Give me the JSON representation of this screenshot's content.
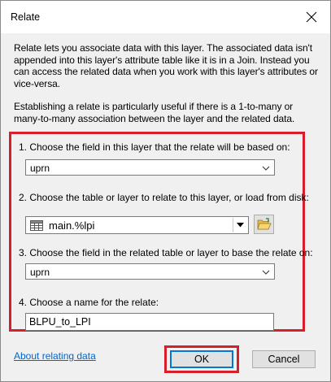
{
  "window": {
    "title": "Relate"
  },
  "description": {
    "paragraph1": "Relate lets you associate data with this layer. The associated data isn't appended into this layer's attribute table like it is in a Join. Instead you can access the related data when you work with this layer's attributes or vice-versa.",
    "paragraph2": "Establishing a relate is particularly useful if there is a 1-to-many or many-to-many association between the layer and the related data."
  },
  "steps": {
    "step1": {
      "label": "1. Choose the field in this layer that the relate will be based on:",
      "value": "uprn"
    },
    "step2": {
      "label": "2. Choose the table or layer to relate to this layer, or load from disk:",
      "value": "main.%lpi"
    },
    "step3": {
      "label": "3. Choose the field in the related table or layer to base the relate on:",
      "value": "uprn"
    },
    "step4": {
      "label": "4. Choose a name for the relate:",
      "value": "BLPU_to_LPI"
    }
  },
  "footer": {
    "help_link": "About relating data",
    "ok_label": "OK",
    "cancel_label": "Cancel"
  },
  "colors": {
    "highlight": "#d61f2a",
    "link": "#0066cc",
    "dialog_bg": "#f0f0f0"
  },
  "icons": {
    "close": "close-icon",
    "dropdown": "chevron-down-icon",
    "table": "table-icon",
    "open_folder": "folder-open-icon"
  }
}
